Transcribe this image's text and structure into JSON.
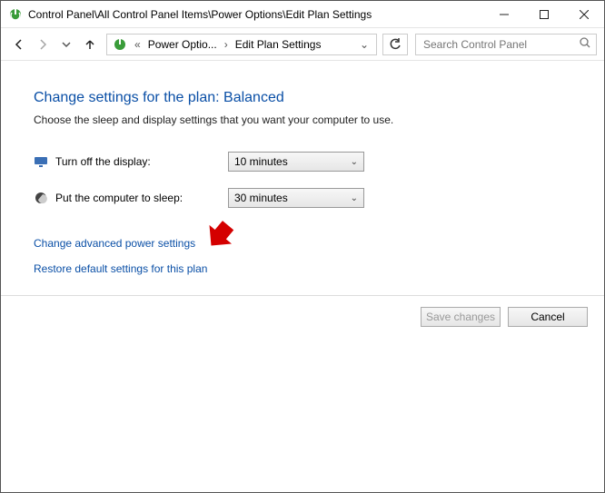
{
  "window": {
    "title": "Control Panel\\All Control Panel Items\\Power Options\\Edit Plan Settings"
  },
  "breadcrumb": {
    "seg1": "Power Optio...",
    "seg2": "Edit Plan Settings"
  },
  "search": {
    "placeholder": "Search Control Panel"
  },
  "page": {
    "heading": "Change settings for the plan: Balanced",
    "subtext": "Choose the sleep and display settings that you want your computer to use."
  },
  "settings": {
    "display_label": "Turn off the display:",
    "display_value": "10 minutes",
    "sleep_label": "Put the computer to sleep:",
    "sleep_value": "30 minutes"
  },
  "links": {
    "advanced": "Change advanced power settings",
    "restore": "Restore default settings for this plan"
  },
  "buttons": {
    "save": "Save changes",
    "cancel": "Cancel"
  }
}
